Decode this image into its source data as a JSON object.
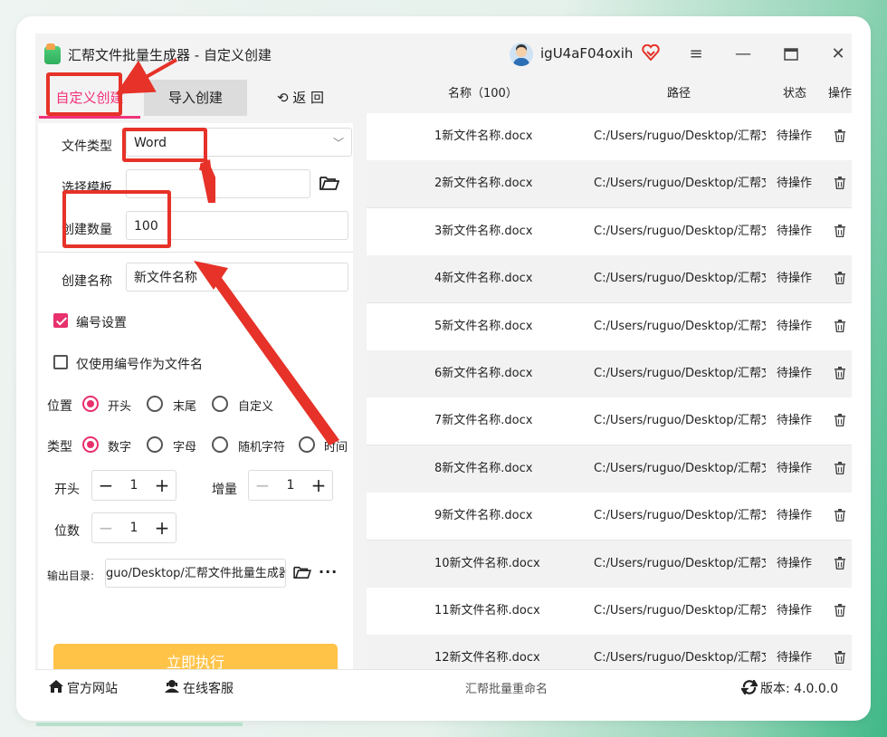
{
  "window": {
    "title": "汇帮文件批量生成器 - 自定义创建",
    "username": "igU4aF04oxih",
    "minimize": "—",
    "close": "✕"
  },
  "tabs": [
    {
      "label": "自定义创建"
    },
    {
      "label": "导入创建"
    },
    {
      "label": "返 回"
    }
  ],
  "form": {
    "file_type_label": "文件类型",
    "file_type_value": "Word",
    "template_label": "选择模板",
    "template_value": "",
    "count_label": "创建数量",
    "count_value": "100",
    "name_label": "创建名称",
    "name_value": "新文件名称",
    "numbering_label": "编号设置",
    "only_number_label": "仅使用编号作为文件名",
    "position_label": "位置",
    "position_options": [
      "开头",
      "末尾",
      "自定义"
    ],
    "type_label": "类型",
    "type_options": [
      "数字",
      "字母",
      "随机字符",
      "时间"
    ],
    "start_label": "开头",
    "start_value": "1",
    "increment_label": "增量",
    "increment_value": "1",
    "digits_label": "位数",
    "digits_value": "1",
    "output_label": "输出目录:",
    "output_value": "guo/Desktop/汇帮文件批量生成器",
    "execute_label": "立即执行"
  },
  "table": {
    "headers": [
      "名称（100）",
      "路径",
      "状态",
      "操作"
    ],
    "rows": [
      {
        "name": "1新文件名称.docx",
        "path": "C:/Users/ruguo/Desktop/汇帮文",
        "status": "待操作"
      },
      {
        "name": "2新文件名称.docx",
        "path": "C:/Users/ruguo/Desktop/汇帮文",
        "status": "待操作"
      },
      {
        "name": "3新文件名称.docx",
        "path": "C:/Users/ruguo/Desktop/汇帮文",
        "status": "待操作"
      },
      {
        "name": "4新文件名称.docx",
        "path": "C:/Users/ruguo/Desktop/汇帮文",
        "status": "待操作"
      },
      {
        "name": "5新文件名称.docx",
        "path": "C:/Users/ruguo/Desktop/汇帮文",
        "status": "待操作"
      },
      {
        "name": "6新文件名称.docx",
        "path": "C:/Users/ruguo/Desktop/汇帮文",
        "status": "待操作"
      },
      {
        "name": "7新文件名称.docx",
        "path": "C:/Users/ruguo/Desktop/汇帮文",
        "status": "待操作"
      },
      {
        "name": "8新文件名称.docx",
        "path": "C:/Users/ruguo/Desktop/汇帮文",
        "status": "待操作"
      },
      {
        "name": "9新文件名称.docx",
        "path": "C:/Users/ruguo/Desktop/汇帮文",
        "status": "待操作"
      },
      {
        "name": "10新文件名称.docx",
        "path": "C:/Users/ruguo/Desktop/汇帮文",
        "status": "待操作"
      },
      {
        "name": "11新文件名称.docx",
        "path": "C:/Users/ruguo/Desktop/汇帮文",
        "status": "待操作"
      },
      {
        "name": "12新文件名称.docx",
        "path": "C:/Users/ruguo/Desktop/汇帮文",
        "status": "待操作"
      }
    ]
  },
  "statusbar": {
    "website": "官方网站",
    "support": "在线客服",
    "center": "汇帮批量重命名",
    "version": "版本:  4.0.0.0"
  },
  "colors": {
    "accent_pink": "#e8306c",
    "execute_yellow": "#ffc348",
    "annotation_red": "#e63228"
  }
}
